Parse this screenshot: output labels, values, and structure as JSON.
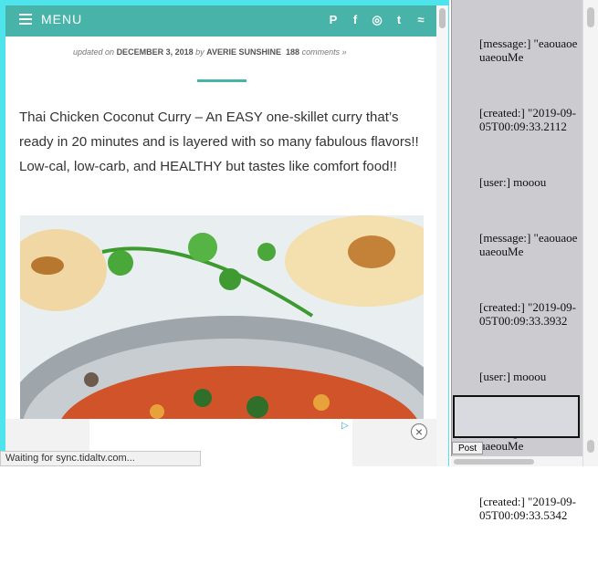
{
  "header": {
    "menu_label": "MENU",
    "social_icons": [
      "pinterest-icon",
      "facebook-icon",
      "instagram-icon",
      "twitter-icon",
      "rss-icon"
    ],
    "accent_color": "#48b4a9"
  },
  "meta": {
    "updated_prefix": "updated on",
    "date": "DECEMBER 3, 2018",
    "by": "by",
    "author": "AVERIE SUNSHINE",
    "comments": "188",
    "comments_suffix": "comments »"
  },
  "intro": "Thai Chicken Coconut Curry – An EASY one-skillet curry that’s ready in 20 minutes and is layered with so many fabulous flavors!! Low-cal, low-carb, and HEALTHY but tastes like comfort food!!",
  "ad": {
    "close_label": "×",
    "play_label": "▷"
  },
  "status": "Waiting for sync.tidaltv.com...",
  "panel": {
    "entries": [
      "[message:] \"eaouaoeuaeouMe",
      "[created:] \"2019-09-05T00:09:33.2112",
      "[user:] mooou",
      "[message:] \"eaouaoeuaeouMe",
      "[created:] \"2019-09-05T00:09:33.3932",
      "[user:] mooou",
      "[message:] \"eaouaoeuaeouMe",
      "[created:] \"2019-09-05T00:09:33.5342"
    ],
    "post_label": "Post"
  }
}
